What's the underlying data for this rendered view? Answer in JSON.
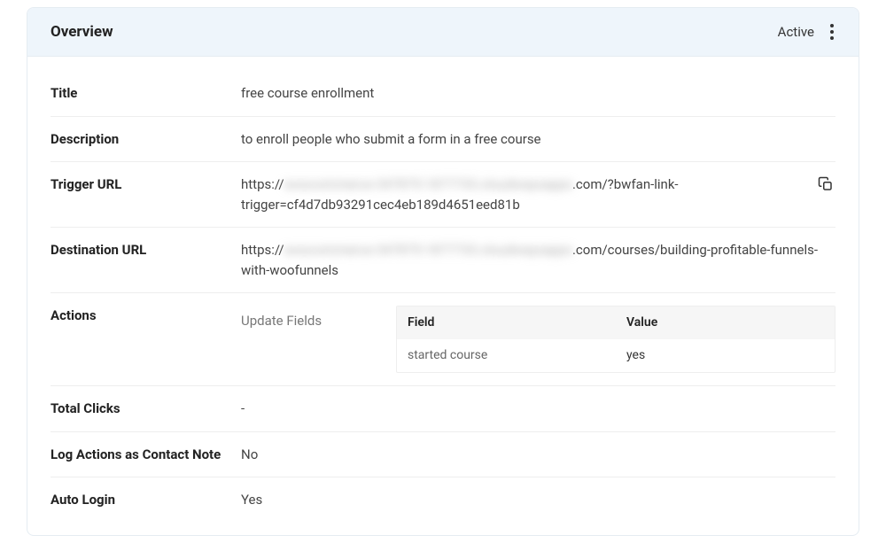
{
  "header": {
    "title": "Overview",
    "status": "Active"
  },
  "fields": {
    "title_label": "Title",
    "title_value": "free course enrollment",
    "description_label": "Description",
    "description_value": "to enroll people who submit a form in a free course",
    "trigger_url_label": "Trigger URL",
    "trigger_url_prefix": "https://",
    "trigger_url_blurred": "woocommerce-347875-1877733.cloudwaysapps",
    "trigger_url_suffix": ".com/?bwfan-link-trigger=cf4d7db93291cec4eb189d4651eed81b",
    "destination_url_label": "Destination URL",
    "destination_url_prefix": "https://",
    "destination_url_blurred": "woocommerce-347875-1877733.cloudwaysapps",
    "destination_url_suffix": ".com/courses/building-profitable-funnels-with-woofunnels",
    "actions_label": "Actions",
    "actions_update_label": "Update Fields",
    "actions_table": {
      "col_field": "Field",
      "col_value": "Value",
      "row_field": "started course",
      "row_value": "yes"
    },
    "total_clicks_label": "Total Clicks",
    "total_clicks_value": "-",
    "log_note_label": "Log Actions as Contact Note",
    "log_note_value": "No",
    "auto_login_label": "Auto Login",
    "auto_login_value": "Yes"
  }
}
